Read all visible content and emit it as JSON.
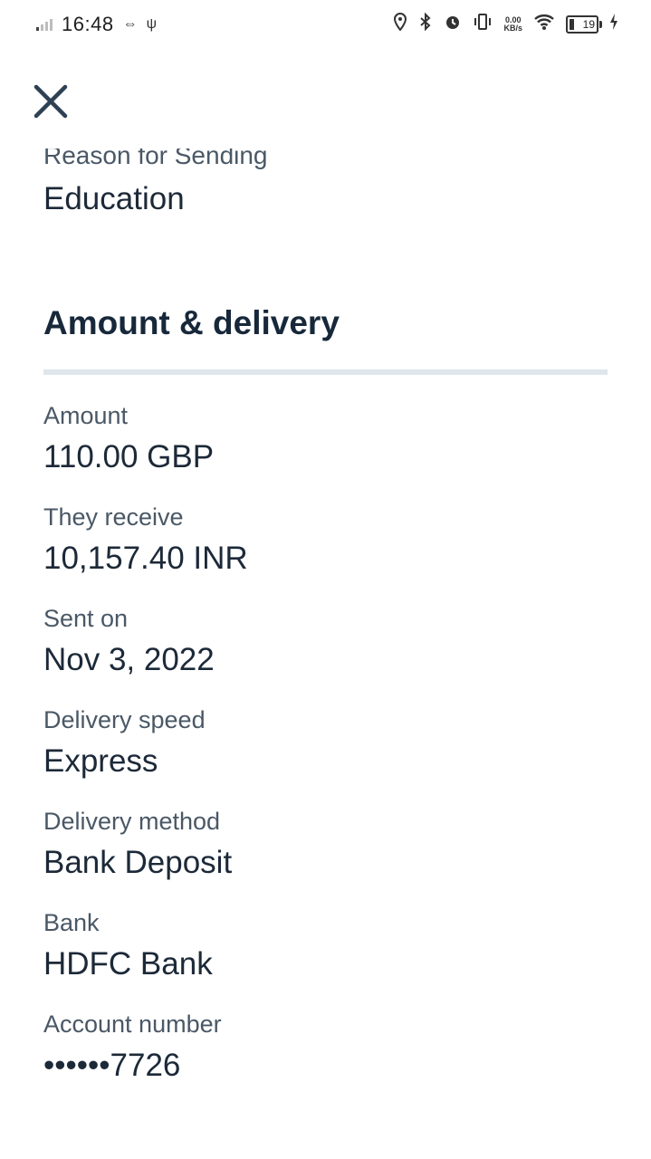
{
  "status_bar": {
    "time": "16:48",
    "net_speed_value": "0.00",
    "net_speed_unit": "KB/s",
    "battery": "19"
  },
  "header": {
    "close_icon": "close-icon"
  },
  "reason": {
    "label": "Reason for Sending",
    "value": "Education"
  },
  "section": {
    "title": "Amount & delivery"
  },
  "fields": [
    {
      "label": "Amount",
      "value": "110.00 GBP"
    },
    {
      "label": "They receive",
      "value": "10,157.40 INR"
    },
    {
      "label": "Sent on",
      "value": "Nov 3, 2022"
    },
    {
      "label": "Delivery speed",
      "value": "Express"
    },
    {
      "label": "Delivery method",
      "value": "Bank Deposit"
    },
    {
      "label": "Bank",
      "value": "HDFC Bank"
    },
    {
      "label": "Account number",
      "value": "••••••7726"
    }
  ]
}
